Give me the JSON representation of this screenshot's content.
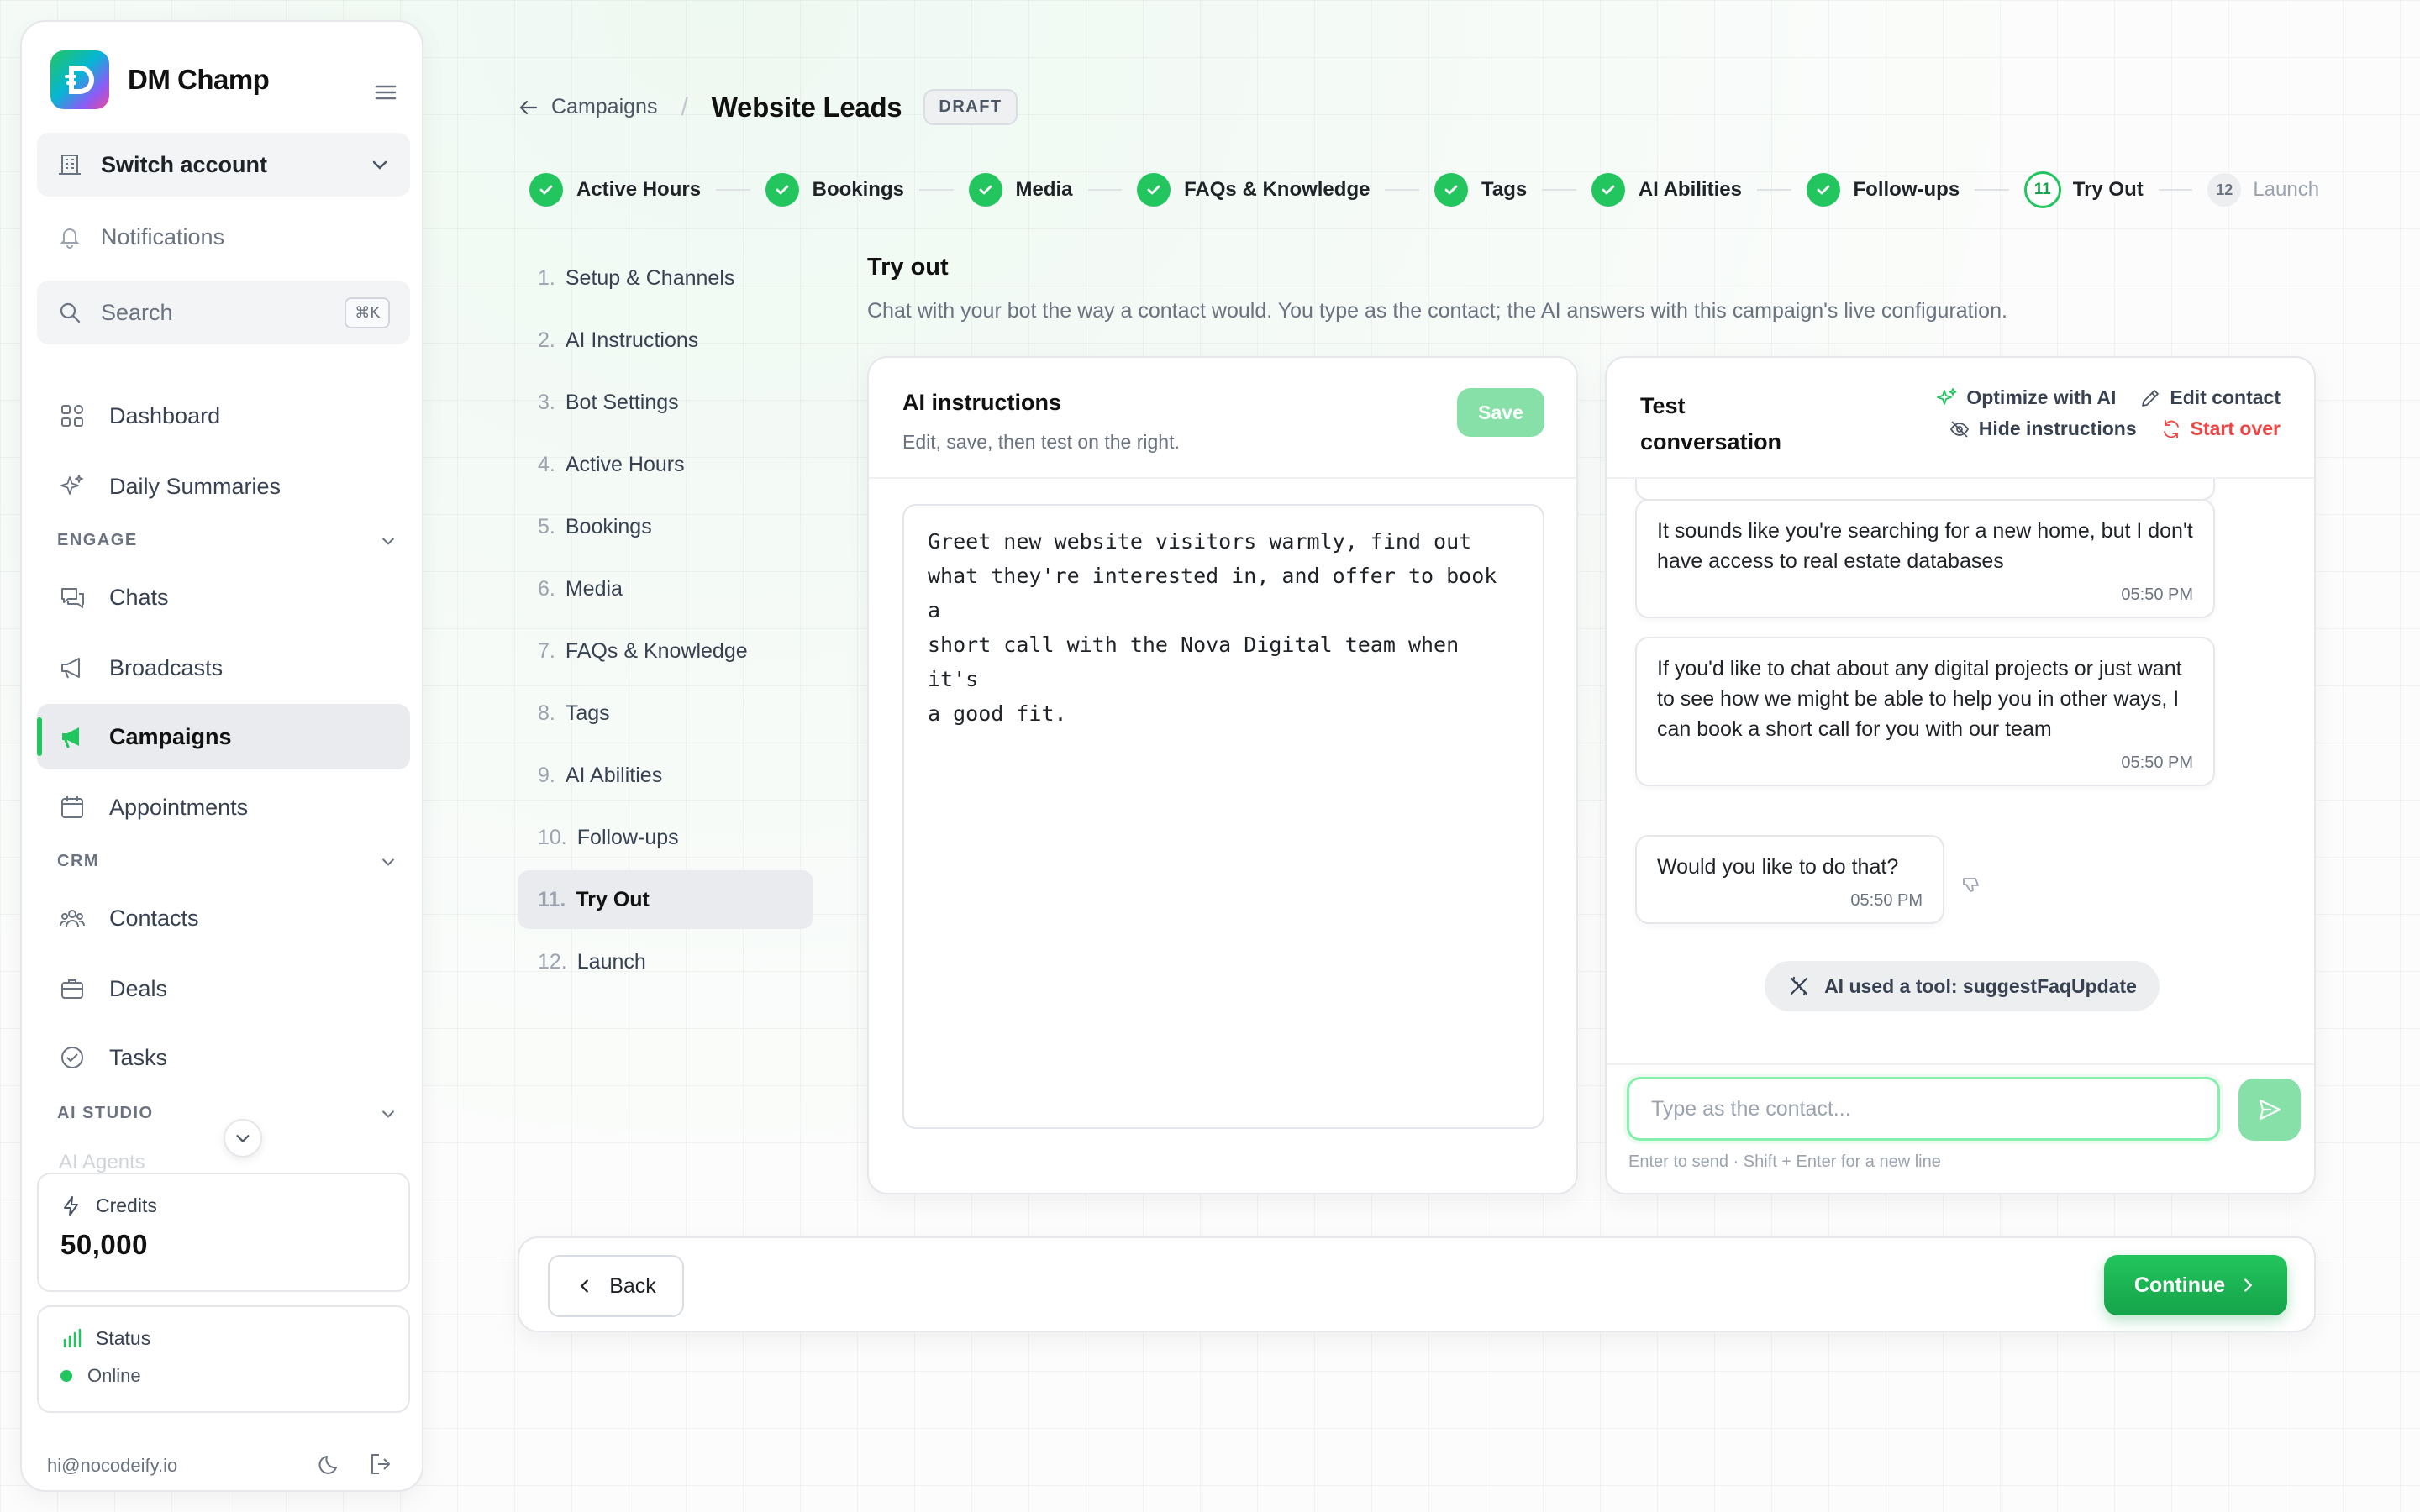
{
  "brand": {
    "name": "DM Champ"
  },
  "sidebar": {
    "switch_account": "Switch account",
    "notifications": "Notifications",
    "search_label": "Search",
    "search_shortcut": "⌘K",
    "items": {
      "dashboard": "Dashboard",
      "daily_summaries": "Daily Summaries",
      "chats": "Chats",
      "broadcasts": "Broadcasts",
      "campaigns": "Campaigns",
      "appointments": "Appointments",
      "contacts": "Contacts",
      "deals": "Deals",
      "tasks": "Tasks",
      "ai_agents": "AI Agents"
    },
    "sections": {
      "engage": "ENGAGE",
      "crm": "CRM",
      "ai_studio": "AI STUDIO"
    },
    "credits_label": "Credits",
    "credits_value": "50,000",
    "status_label": "Status",
    "status_value": "Online",
    "user_email": "hi@nocodeify.io"
  },
  "header": {
    "back_label": "Campaigns",
    "title": "Website Leads",
    "badge": "DRAFT"
  },
  "stepper": {
    "steps": [
      {
        "label": "Active Hours",
        "state": "done"
      },
      {
        "label": "Bookings",
        "state": "done"
      },
      {
        "label": "Media",
        "state": "done"
      },
      {
        "label": "FAQs & Knowledge",
        "state": "done"
      },
      {
        "label": "Tags",
        "state": "done"
      },
      {
        "label": "AI Abilities",
        "state": "done"
      },
      {
        "label": "Follow-ups",
        "state": "done"
      },
      {
        "label": "Try Out",
        "state": "current",
        "number": "11"
      },
      {
        "label": "Launch",
        "state": "pending",
        "number": "12"
      }
    ]
  },
  "step_list": {
    "items": [
      {
        "num": "1.",
        "label": "Setup & Channels"
      },
      {
        "num": "2.",
        "label": "AI Instructions"
      },
      {
        "num": "3.",
        "label": "Bot Settings"
      },
      {
        "num": "4.",
        "label": "Active Hours"
      },
      {
        "num": "5.",
        "label": "Bookings"
      },
      {
        "num": "6.",
        "label": "Media"
      },
      {
        "num": "7.",
        "label": "FAQs & Knowledge"
      },
      {
        "num": "8.",
        "label": "Tags"
      },
      {
        "num": "9.",
        "label": "AI Abilities"
      },
      {
        "num": "10.",
        "label": "Follow-ups"
      },
      {
        "num": "11.",
        "label": "Try Out"
      },
      {
        "num": "12.",
        "label": "Launch"
      }
    ]
  },
  "content": {
    "title": "Try out",
    "description": "Chat with your bot the way a contact would. You type as the contact; the AI answers with this campaign's live configuration."
  },
  "ai_panel": {
    "title": "AI instructions",
    "subtitle": "Edit, save, then test on the right.",
    "save_label": "Save",
    "instructions": "Greet new website visitors warmly, find out\nwhat they're interested in, and offer to book a\nshort call with the Nova Digital team when it's\na good fit."
  },
  "chat_panel": {
    "title": "Test conversation",
    "optimize_label": "Optimize with AI",
    "edit_contact_label": "Edit contact",
    "hide_instructions_label": "Hide instructions",
    "start_over_label": "Start over",
    "messages": [
      {
        "text": "It sounds like you're searching for a new home, but I don't have access to real estate databases",
        "time": "05:50 PM"
      },
      {
        "text": "If you'd like to chat about any digital projects or just want to see how we might be able to help you in other ways, I can book a short call for you with our team",
        "time": "05:50 PM"
      },
      {
        "text": "Would you like to do that?",
        "time": "05:50 PM"
      }
    ],
    "tool_chip": "AI used a tool: suggestFaqUpdate",
    "input_placeholder": "Type as the contact...",
    "hint": "Enter to send · Shift + Enter for a new line"
  },
  "footer": {
    "back_label": "Back",
    "continue_label": "Continue"
  },
  "colors": {
    "accent": "#22c55e",
    "danger": "#ef4444"
  }
}
